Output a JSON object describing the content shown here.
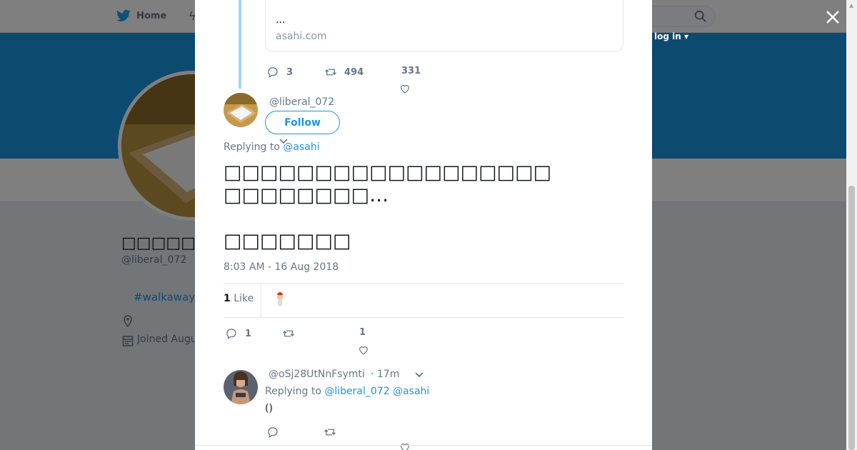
{
  "background": {
    "nav": {
      "home_label": "Home",
      "login_label": "log in ▾"
    },
    "profile": {
      "name": "□□□□□□□□□",
      "handle": "@liberal_072",
      "hashtag": "#walkaway",
      "joined": "Joined August"
    }
  },
  "tweet_above": {
    "card": {
      "ellipsis": "...",
      "domain": "asahi.com"
    },
    "actions": {
      "replies": "3",
      "retweets": "494",
      "likes": "331"
    }
  },
  "tweet": {
    "handle": "@liberal_072",
    "follow_label": "Follow",
    "replying_prefix": "Replying to ",
    "replying_to": "@asahi",
    "text_line1": "□□□□□□□□□□□□□□□□□□",
    "text_line2": "□□□□□□□□…",
    "text_line3": "□□□□□□□",
    "timestamp": "8:03 AM - 16 Aug 2018",
    "likes_count": "1",
    "likes_label": " Like",
    "actions": {
      "replies": "1",
      "retweets": "",
      "likes": "1"
    }
  },
  "reply": {
    "handle": "@oSj28UtNnFsymti",
    "time": "· 17m",
    "replying_prefix": "Replying to ",
    "mention1": "@liberal_072",
    "mention2": "@asahi",
    "text": "()"
  },
  "colors": {
    "accent": "#1b95e0",
    "banner": "#1b95e0",
    "thread_line": "#a3d7f2"
  }
}
